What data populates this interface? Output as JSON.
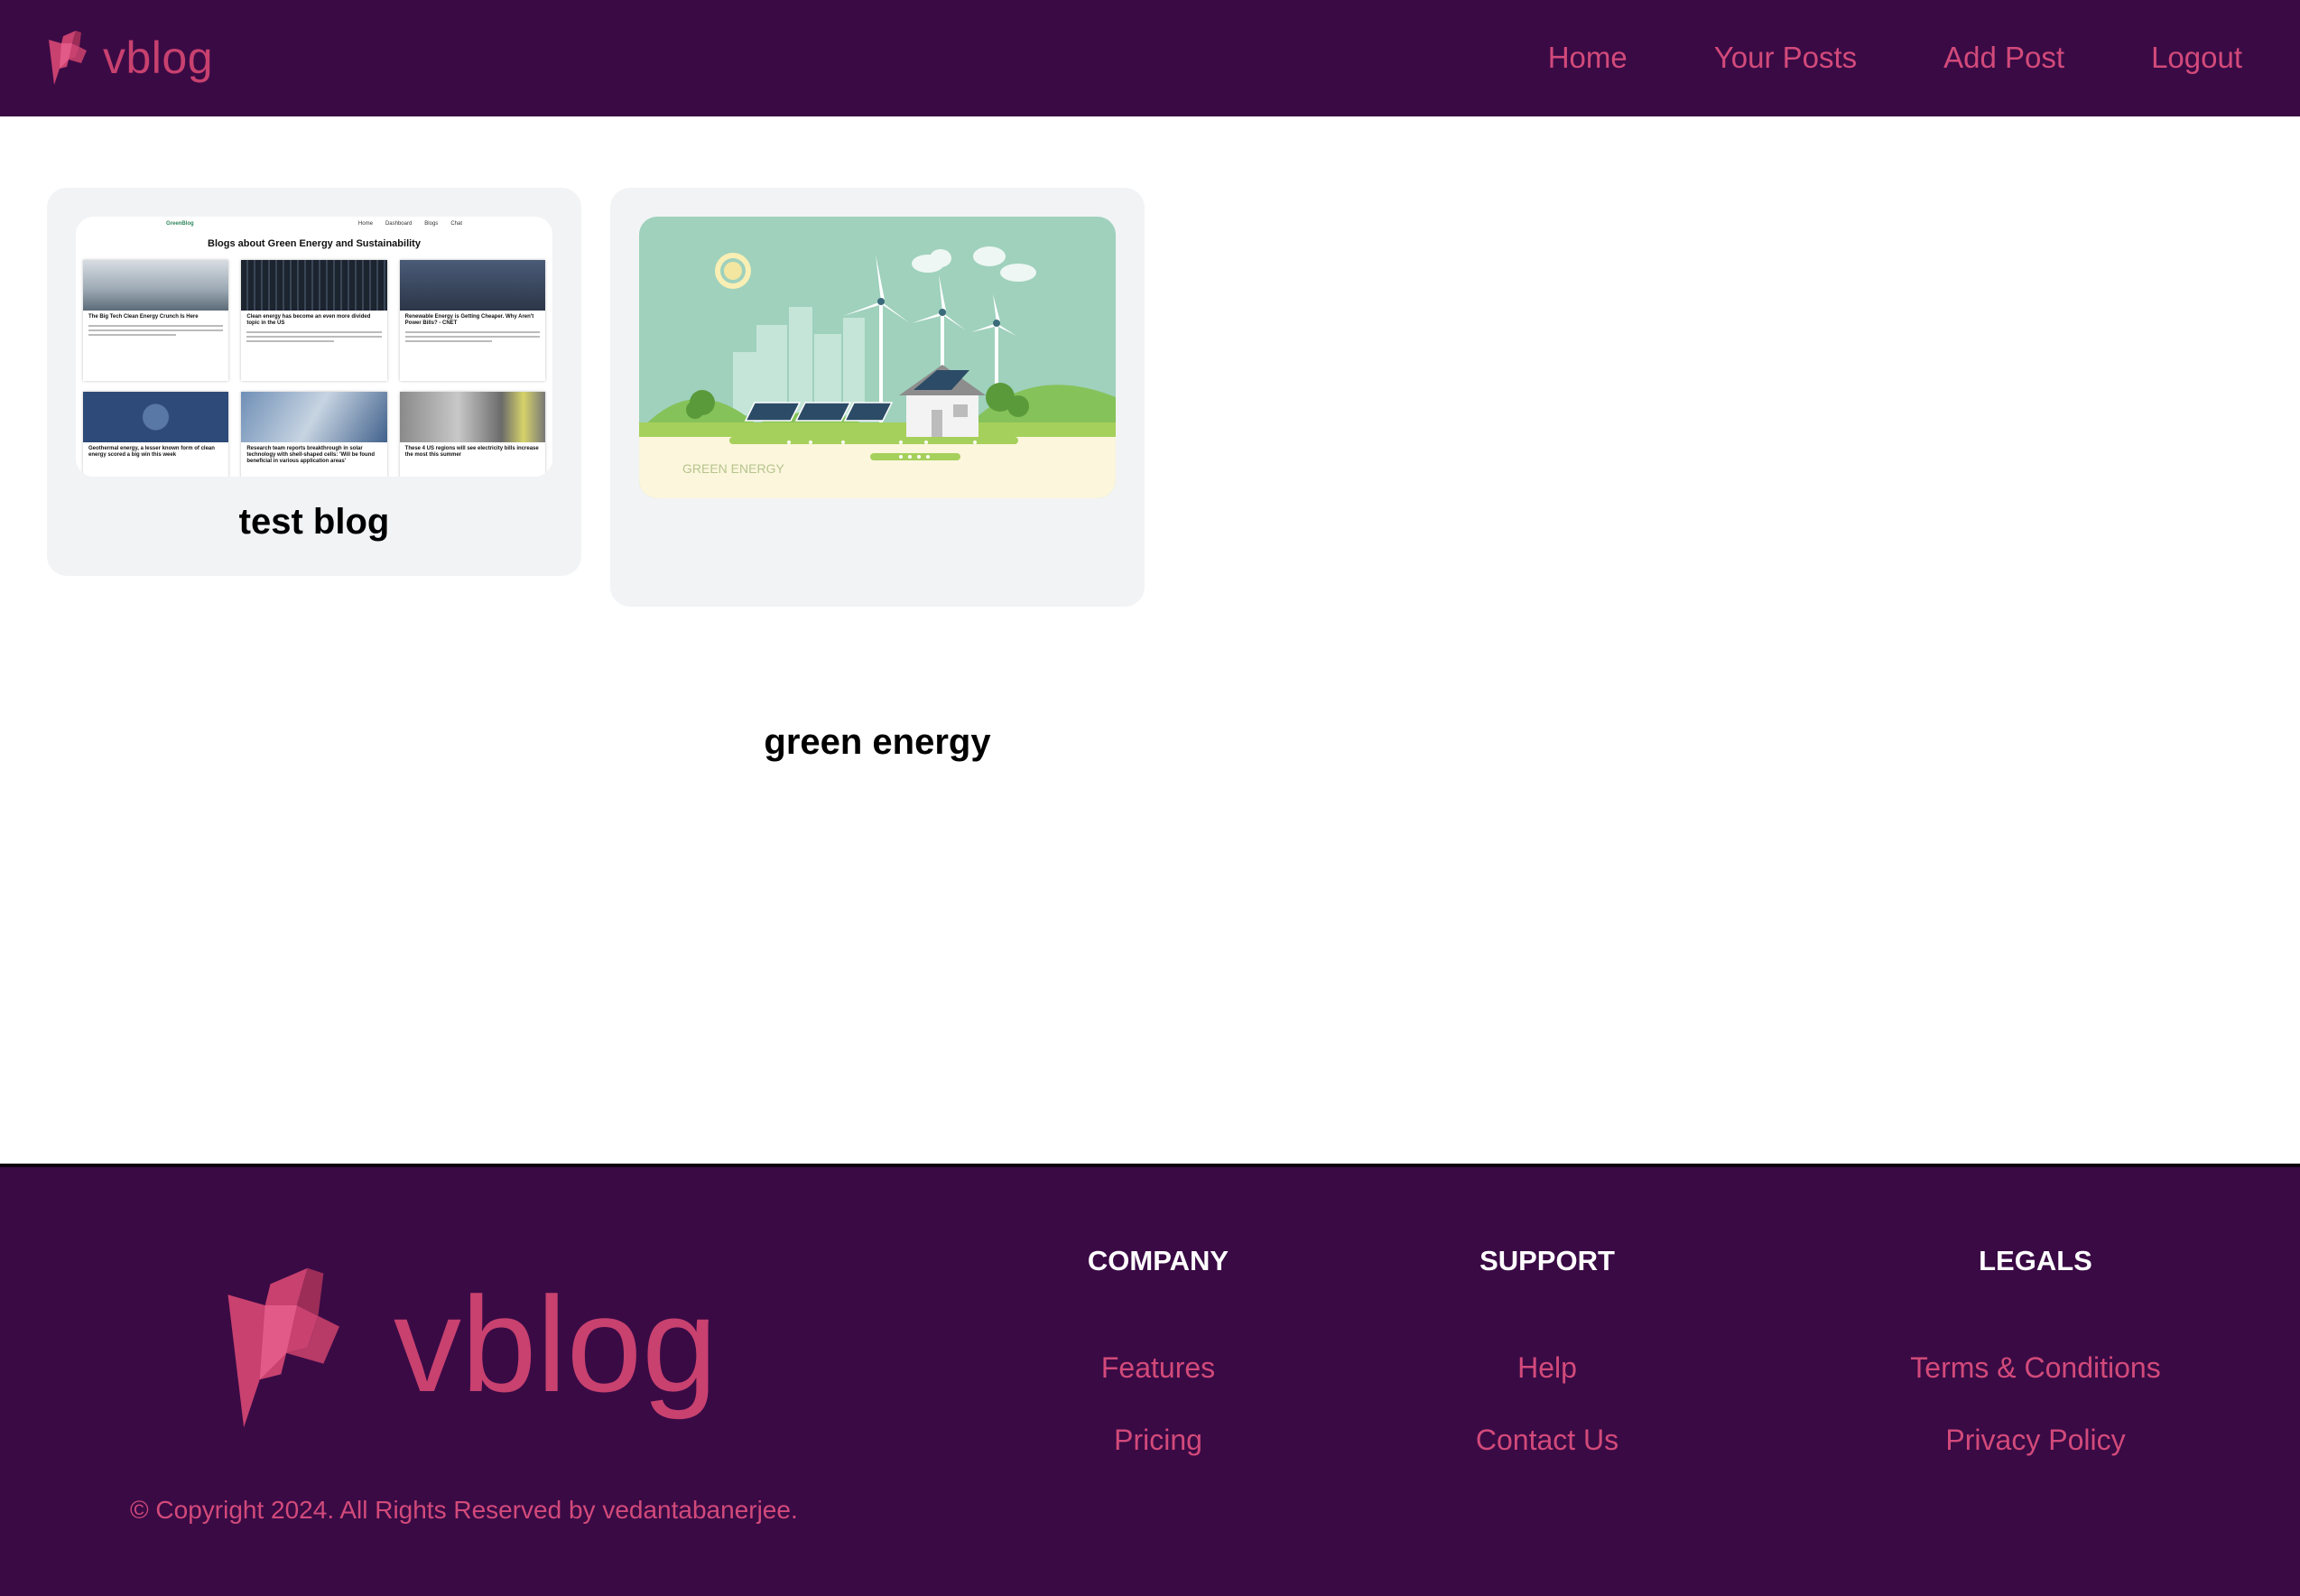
{
  "header": {
    "brand": "vblog",
    "nav": [
      "Home",
      "Your Posts",
      "Add Post",
      "Logout"
    ]
  },
  "posts": [
    {
      "title": "test blog",
      "thumbnail": {
        "brand": "GreenBlog",
        "nav": [
          "Home",
          "Dashboard",
          "Blogs",
          "Chat"
        ],
        "heading": "Blogs about Green Energy and Sustainability",
        "articles": [
          "The Big Tech Clean Energy Crunch Is Here",
          "Clean energy has become an even more divided topic in the US",
          "Renewable Energy is Getting Cheaper. Why Aren't Power Bills? - CNET",
          "Geothermal energy, a lesser known form of clean energy scored a big win this week",
          "Research team reports breakthrough in solar technology with shell-shaped cells: 'Will be found beneficial in various application areas'",
          "These 4 US regions will see electricity bills increase the most this summer"
        ]
      }
    },
    {
      "title": "green energy",
      "thumbnail": {
        "caption": "GREEN ENERGY"
      }
    }
  ],
  "footer": {
    "brand": "vblog",
    "copyright": "© Copyright 2024. All Rights Reserved by vedantabanerjee.",
    "columns": [
      {
        "heading": "COMPANY",
        "links": [
          "Features",
          "Pricing"
        ]
      },
      {
        "heading": "SUPPORT",
        "links": [
          "Help",
          "Contact Us"
        ]
      },
      {
        "heading": "LEGALS",
        "links": [
          "Terms & Conditions",
          "Privacy Policy"
        ]
      }
    ]
  },
  "colors": {
    "header_bg": "#3a0a45",
    "accent": "#c8416f",
    "card_bg": "#f2f3f5"
  }
}
